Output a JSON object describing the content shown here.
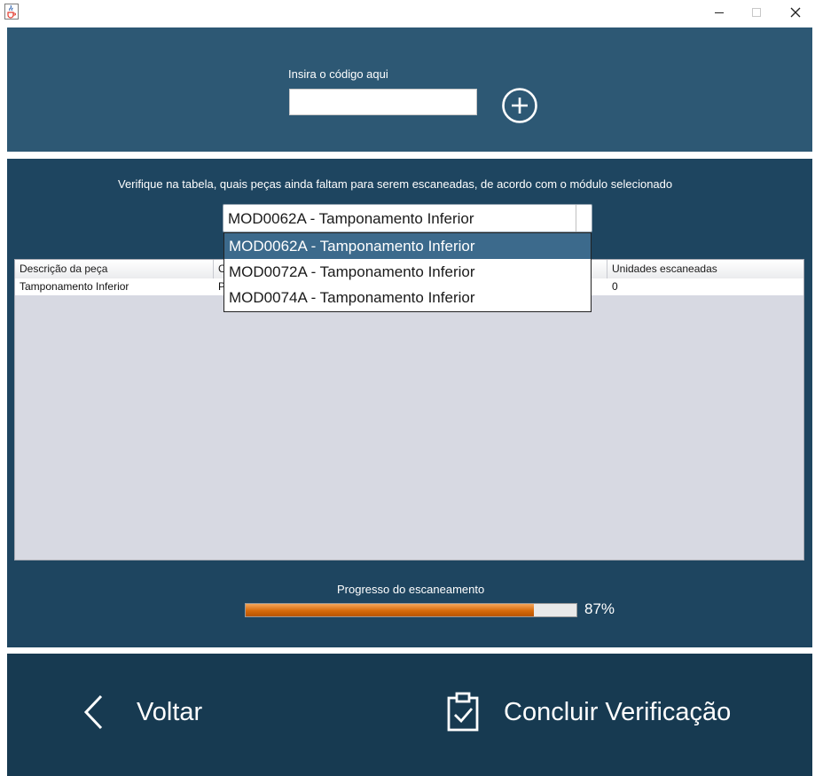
{
  "window": {
    "icon": "java-cup-icon",
    "controls": [
      "minimize-icon",
      "maximize-icon",
      "close-icon"
    ]
  },
  "code_entry": {
    "label": "Insira o código aqui",
    "value": "",
    "add_icon": "plus-circle-icon"
  },
  "verification": {
    "instructions": "Verifique na tabela, quais peças ainda faltam para serem escaneadas, de acordo com o módulo selecionado",
    "module_select": {
      "selected": "MOD0062A - Tamponamento Inferior",
      "options": [
        "MOD0062A - Tamponamento Inferior",
        "MOD0072A - Tamponamento Inferior",
        "MOD0074A - Tamponamento Inferior"
      ],
      "highlighted_index": 0
    },
    "table": {
      "columns": [
        "Descrição da peça",
        "C",
        "Unidades escaneadas"
      ],
      "rows": [
        [
          "Tamponamento Inferior",
          "P",
          "0"
        ]
      ]
    },
    "progress": {
      "label": "Progresso do escaneamento",
      "value_text": "87%",
      "fraction": 0.87
    }
  },
  "footer": {
    "back_label": "Voltar",
    "back_icon": "chevron-left-icon",
    "finish_label": "Concluir Verificação",
    "finish_icon": "clipboard-check-icon"
  },
  "colors": {
    "top_panel": "#2d5874",
    "middle_panel": "#1e4560",
    "bottom_panel": "#173a51",
    "selected_option": "#3c6a8c",
    "progress_fill": "#d66a0b"
  }
}
